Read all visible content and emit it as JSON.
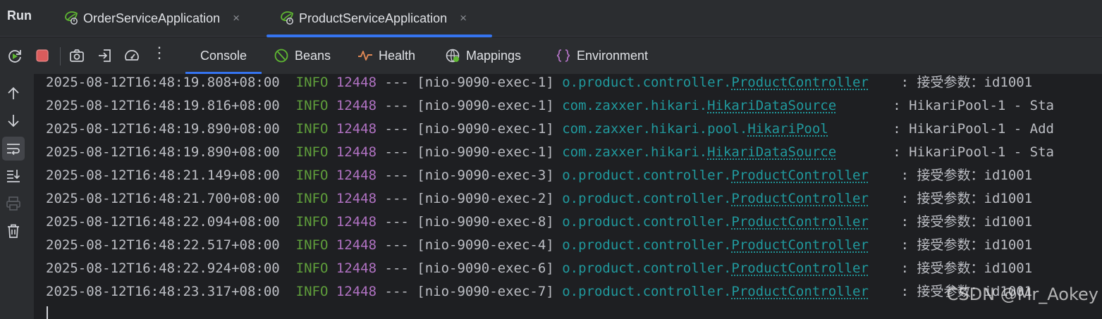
{
  "run_panel": {
    "title": "Run",
    "tabs": [
      {
        "label": "OrderServiceApplication",
        "active": false,
        "close_glyph": "×"
      },
      {
        "label": "ProductServiceApplication",
        "active": true,
        "close_glyph": "×"
      }
    ]
  },
  "toolbar": {
    "actions": [
      {
        "icon": "rerun-icon"
      },
      {
        "icon": "stop-icon"
      },
      {
        "icon": "camera-icon"
      },
      {
        "icon": "exit-icon"
      },
      {
        "icon": "gauge-icon"
      },
      {
        "icon": "more-vertical-icon",
        "glyph": "⋮"
      }
    ],
    "tabs": [
      {
        "label": "Console",
        "icon": "",
        "active": true
      },
      {
        "label": "Beans",
        "icon": "beans-icon",
        "active": false
      },
      {
        "label": "Health",
        "icon": "health-icon",
        "active": false
      },
      {
        "label": "Mappings",
        "icon": "mappings-icon",
        "active": false
      },
      {
        "label": "Environment",
        "icon": "environment-icon",
        "active": false
      }
    ]
  },
  "gutter": {
    "icons": [
      "arrow-up-icon",
      "arrow-down-icon",
      "soft-wrap-icon",
      "scroll-to-end-icon",
      "print-icon",
      "trash-icon"
    ],
    "active": "soft-wrap-icon"
  },
  "console": {
    "lines": [
      {
        "ts": "2025-08-12T16:48:19.808+08:00",
        "level": "INFO",
        "pid": "12448",
        "sep": "---",
        "thread": "[nio-9090-exec-1]",
        "logger_pkg": "o.product.controller.",
        "logger_cls": "ProductController",
        "message": "接受参数：id1001"
      },
      {
        "ts": "2025-08-12T16:48:19.816+08:00",
        "level": "INFO",
        "pid": "12448",
        "sep": "---",
        "thread": "[nio-9090-exec-1]",
        "logger_pkg": "com.zaxxer.hikari.",
        "logger_cls": "HikariDataSource",
        "message": "HikariPool-1 - Sta"
      },
      {
        "ts": "2025-08-12T16:48:19.890+08:00",
        "level": "INFO",
        "pid": "12448",
        "sep": "---",
        "thread": "[nio-9090-exec-1]",
        "logger_pkg": "com.zaxxer.hikari.pool.",
        "logger_cls": "HikariPool",
        "message": "HikariPool-1 - Add"
      },
      {
        "ts": "2025-08-12T16:48:19.890+08:00",
        "level": "INFO",
        "pid": "12448",
        "sep": "---",
        "thread": "[nio-9090-exec-1]",
        "logger_pkg": "com.zaxxer.hikari.",
        "logger_cls": "HikariDataSource",
        "message": "HikariPool-1 - Sta"
      },
      {
        "ts": "2025-08-12T16:48:21.149+08:00",
        "level": "INFO",
        "pid": "12448",
        "sep": "---",
        "thread": "[nio-9090-exec-3]",
        "logger_pkg": "o.product.controller.",
        "logger_cls": "ProductController",
        "message": "接受参数：id1001"
      },
      {
        "ts": "2025-08-12T16:48:21.700+08:00",
        "level": "INFO",
        "pid": "12448",
        "sep": "---",
        "thread": "[nio-9090-exec-2]",
        "logger_pkg": "o.product.controller.",
        "logger_cls": "ProductController",
        "message": "接受参数：id1001"
      },
      {
        "ts": "2025-08-12T16:48:22.094+08:00",
        "level": "INFO",
        "pid": "12448",
        "sep": "---",
        "thread": "[nio-9090-exec-8]",
        "logger_pkg": "o.product.controller.",
        "logger_cls": "ProductController",
        "message": "接受参数：id1001"
      },
      {
        "ts": "2025-08-12T16:48:22.517+08:00",
        "level": "INFO",
        "pid": "12448",
        "sep": "---",
        "thread": "[nio-9090-exec-4]",
        "logger_pkg": "o.product.controller.",
        "logger_cls": "ProductController",
        "message": "接受参数：id1001"
      },
      {
        "ts": "2025-08-12T16:48:22.924+08:00",
        "level": "INFO",
        "pid": "12448",
        "sep": "---",
        "thread": "[nio-9090-exec-6]",
        "logger_pkg": "o.product.controller.",
        "logger_cls": "ProductController",
        "message": "接受参数：id1001"
      },
      {
        "ts": "2025-08-12T16:48:23.317+08:00",
        "level": "INFO",
        "pid": "12448",
        "sep": "---",
        "thread": "[nio-9090-exec-7]",
        "logger_pkg": "o.product.controller.",
        "logger_cls": "ProductController",
        "message": "接受参数：id1001"
      }
    ]
  },
  "watermark": "CSDN @Mr_Aokey",
  "colors": {
    "accent": "#3574f0",
    "log_level": "#5f9e3b",
    "pid": "#b072c2",
    "logger": "#20999d",
    "stop": "#db5c5c",
    "health": "#e08855"
  }
}
